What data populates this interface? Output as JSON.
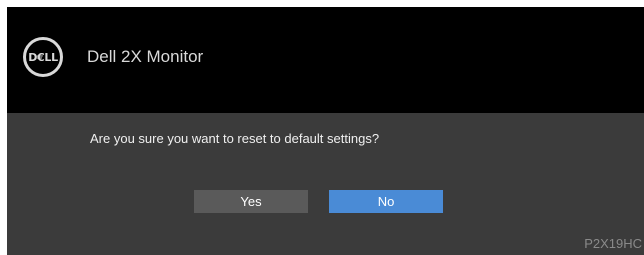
{
  "header": {
    "logo_text": "D€LL",
    "title": "Dell 2X Monitor"
  },
  "dialog": {
    "question": "Are you sure you want to reset to default settings?",
    "buttons": {
      "yes_label": "Yes",
      "no_label": "No"
    },
    "selected": "No"
  },
  "footer": {
    "model": "P2X19HC"
  },
  "colors": {
    "header_bg": "#000000",
    "panel_bg": "#3b3b3b",
    "yes_bg": "#5a5a5a",
    "no_bg_selected": "#4a8bd6"
  }
}
